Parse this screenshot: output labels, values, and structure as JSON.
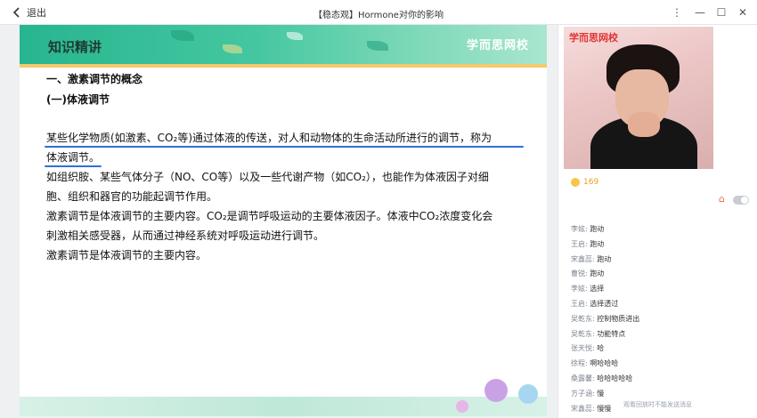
{
  "window": {
    "back_label": "退出",
    "title": "【稳态观】Hormone对你的影响"
  },
  "slide": {
    "header_title": "知识精讲",
    "header_brand": "学而思网校",
    "section1": "一、激素调节的概念",
    "section2": "(一)体液调节",
    "lines": [
      "某些化学物质(如激素、CO₂等)通过体液的传送，对人和动物体的生命活动所进行的调节，称为",
      "体液调节。",
      "如组织胺、某些气体分子（NO、CO等）以及一些代谢产物（如CO₂），也能作为体液因子对细",
      "胞、组织和器官的功能起调节作用。",
      "激素调节是体液调节的主要内容。CO₂是调节呼吸运动的主要体液因子。体液中CO₂浓度变化会",
      "刺激相关感受器，从而通过神经系统对呼吸运动进行调节。",
      "激素调节是体液调节的主要内容。"
    ]
  },
  "panel": {
    "video_brand": "学而思网校",
    "online_count": "169",
    "messages": [
      {
        "user": "李妶:",
        "text": "跑动"
      },
      {
        "user": "王启:",
        "text": "跑动"
      },
      {
        "user": "宋鑫蕊:",
        "text": "跑动"
      },
      {
        "user": "曹锐:",
        "text": "跑动"
      },
      {
        "user": "李妶:",
        "text": "选择"
      },
      {
        "user": "王启:",
        "text": "选择透过"
      },
      {
        "user": "吴乾东:",
        "text": "控制物质进出"
      },
      {
        "user": "吴乾东:",
        "text": "功能特点"
      },
      {
        "user": "张天悦:",
        "text": "哈"
      },
      {
        "user": "徐程:",
        "text": "啊哈哈哈"
      },
      {
        "user": "桑露馨:",
        "text": "哈哈哈哈哈"
      },
      {
        "user": "方子涵:",
        "text": "慢"
      },
      {
        "user": "宋鑫蕊:",
        "text": "慢慢"
      }
    ],
    "footer_note": "观看回放时不能发送消息"
  }
}
